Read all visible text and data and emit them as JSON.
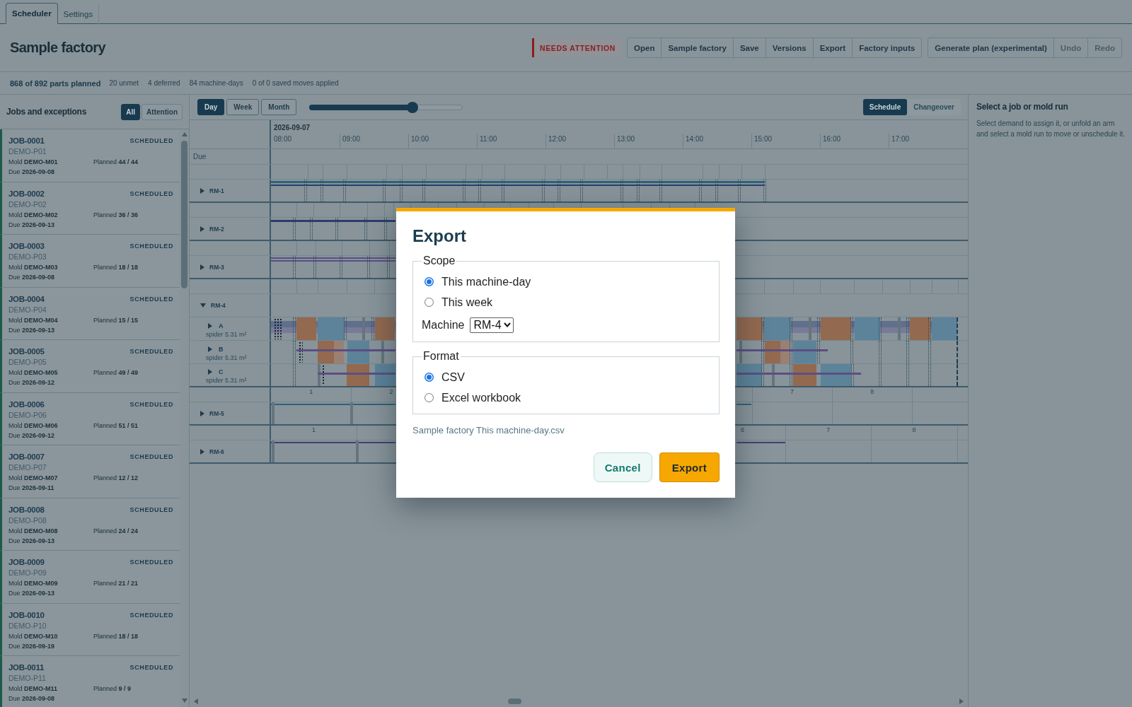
{
  "tabs": [
    {
      "label": "Scheduler",
      "selected": true
    },
    {
      "label": "Settings",
      "selected": false
    }
  ],
  "header": {
    "title": "Sample factory",
    "alert": "NEEDS ATTENTION",
    "file_buttons": [
      {
        "label": "Open",
        "disabled": false
      },
      {
        "label": "Sample factory",
        "disabled": false
      },
      {
        "label": "Save",
        "disabled": false
      },
      {
        "label": "Versions",
        "disabled": false
      },
      {
        "label": "Export",
        "disabled": false
      },
      {
        "label": "Factory inputs",
        "disabled": false
      }
    ],
    "plan_buttons": [
      {
        "label": "Generate plan (experimental)",
        "disabled": false
      },
      {
        "label": "Undo",
        "disabled": true
      },
      {
        "label": "Redo",
        "disabled": true
      }
    ]
  },
  "summary": {
    "headline": "868 of 892 parts planned",
    "stats": [
      "20 unmet",
      "4 deferred",
      "84 machine-days",
      "0 of 0 saved moves applied"
    ]
  },
  "sidebar": {
    "title": "Jobs and exceptions",
    "filters": [
      {
        "label": "All",
        "selected": true
      },
      {
        "label": "Attention",
        "selected": false
      }
    ],
    "jobs": [
      {
        "id": "JOB-0001",
        "status": "SCHEDULED",
        "part": "DEMO-P01",
        "mold": "Mold **DEMO-M01**",
        "planned": "Planned **44 / 44**",
        "due": "Due **2026-09-08**"
      },
      {
        "id": "JOB-0002",
        "status": "SCHEDULED",
        "part": "DEMO-P02",
        "mold": "Mold **DEMO-M02**",
        "planned": "Planned **36 / 36**",
        "due": "Due **2026-09-13**"
      },
      {
        "id": "JOB-0003",
        "status": "SCHEDULED",
        "part": "DEMO-P03",
        "mold": "Mold **DEMO-M03**",
        "planned": "Planned **18 / 18**",
        "due": "Due **2026-09-08**"
      },
      {
        "id": "JOB-0004",
        "status": "SCHEDULED",
        "part": "DEMO-P04",
        "mold": "Mold **DEMO-M04**",
        "planned": "Planned **15 / 15**",
        "due": "Due **2026-09-13**"
      },
      {
        "id": "JOB-0005",
        "status": "SCHEDULED",
        "part": "DEMO-P05",
        "mold": "Mold **DEMO-M05**",
        "planned": "Planned **49 / 49**",
        "due": "Due **2026-09-12**"
      },
      {
        "id": "JOB-0006",
        "status": "SCHEDULED",
        "part": "DEMO-P06",
        "mold": "Mold **DEMO-M06**",
        "planned": "Planned **51 / 51**",
        "due": "Due **2026-09-12**"
      },
      {
        "id": "JOB-0007",
        "status": "SCHEDULED",
        "part": "DEMO-P07",
        "mold": "Mold **DEMO-M07**",
        "planned": "Planned **12 / 12**",
        "due": "Due **2026-09-11**"
      },
      {
        "id": "JOB-0008",
        "status": "SCHEDULED",
        "part": "DEMO-P08",
        "mold": "Mold **DEMO-M08**",
        "planned": "Planned **24 / 24**",
        "due": "Due **2026-09-13**"
      },
      {
        "id": "JOB-0009",
        "status": "SCHEDULED",
        "part": "DEMO-P09",
        "mold": "Mold **DEMO-M09**",
        "planned": "Planned **21 / 21**",
        "due": "Due **2026-09-13**"
      },
      {
        "id": "JOB-0010",
        "status": "SCHEDULED",
        "part": "DEMO-P10",
        "mold": "Mold **DEMO-M10**",
        "planned": "Planned **18 / 18**",
        "due": "Due **2026-09-19**"
      },
      {
        "id": "JOB-0011",
        "status": "SCHEDULED",
        "part": "DEMO-P11",
        "mold": "Mold **DEMO-M11**",
        "planned": "Planned **9 / 9**",
        "due": "Due **2026-09-08**"
      }
    ]
  },
  "schedule": {
    "views": [
      {
        "label": "Day",
        "selected": true
      },
      {
        "label": "Week",
        "selected": false
      },
      {
        "label": "Month",
        "selected": false
      }
    ],
    "zoom": {
      "level": 0.67
    },
    "modes": [
      {
        "label": "Schedule",
        "selected": true
      },
      {
        "label": "Changeover",
        "selected": false
      }
    ],
    "date": "2026-09-07",
    "hours": [
      "08:00",
      "09:00",
      "10:00",
      "11:00",
      "12:00",
      "13:00",
      "14:00",
      "15:00",
      "16:00",
      "17:00"
    ],
    "due_label": "Due",
    "machines": [
      {
        "name": "RM-1",
        "expanded": false
      },
      {
        "name": "RM-2",
        "expanded": false
      },
      {
        "name": "RM-3",
        "expanded": false
      },
      {
        "name": "RM-4",
        "expanded": true,
        "children": [
          {
            "name": "A",
            "detail": "spider 5.31 m²",
            "expanded": false
          },
          {
            "name": "B",
            "detail": "spider 5.31 m²",
            "expanded": false
          },
          {
            "name": "C",
            "detail": "spider 5.31 m²",
            "expanded": false
          }
        ]
      },
      {
        "name": "RM-5",
        "expanded": false,
        "run_numbers": [
          "1",
          "2",
          "7",
          "8"
        ]
      },
      {
        "name": "RM-6",
        "expanded": false,
        "run_numbers": [
          "1",
          "6",
          "7",
          "8"
        ]
      }
    ]
  },
  "detail": {
    "title": "Select a job or mold run",
    "text": "Select demand to assign it, or unfold an arm and select a mold run to move or unschedule it."
  },
  "dialog": {
    "title": "Export",
    "groups": [
      {
        "legend": "Scope",
        "options": [
          {
            "label": "This machine-day",
            "selected": true
          },
          {
            "label": "This week",
            "selected": false
          }
        ],
        "field": {
          "label": "Machine",
          "value": "RM-4"
        }
      },
      {
        "legend": "Format",
        "options": [
          {
            "label": "CSV",
            "selected": true
          },
          {
            "label": "Excel workbook",
            "selected": false
          }
        ]
      }
    ],
    "filename": "Sample factory This machine-day.csv",
    "buttons": [
      {
        "label": "Cancel",
        "kind": "secondary"
      },
      {
        "label": "Export",
        "kind": "primary"
      }
    ]
  }
}
